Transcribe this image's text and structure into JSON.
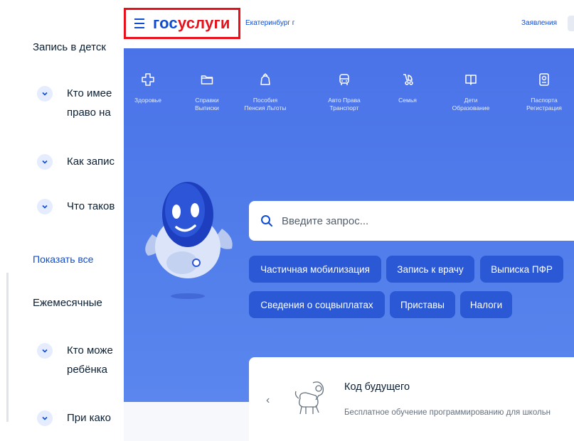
{
  "background": {
    "section1_heading": "Запись в детск",
    "faq_1_line1": "Кто имее",
    "faq_1_line2": "право на",
    "faq_2": "Как запис",
    "faq_3": "Что таков",
    "show_all": "Показать все",
    "section2_heading": "Ежемесячные",
    "faq_4_line1": "Кто може",
    "faq_4_line2": "ребёнка",
    "faq_5": "При како"
  },
  "header": {
    "logo_part1": "гос",
    "logo_part2": "услуги",
    "city": "Екатеринбург г",
    "statements_link": "Заявления"
  },
  "categories": [
    {
      "icon": "health-icon",
      "line1": "Здоровье",
      "line2": ""
    },
    {
      "icon": "folder-icon",
      "line1": "Справки",
      "line2": "Выписки"
    },
    {
      "icon": "benefits-icon",
      "line1": "Пособия",
      "line2": "Пенсия Льготы"
    },
    {
      "icon": "car-icon",
      "line1": "Авто Права",
      "line2": "Транспорт"
    },
    {
      "icon": "stroller-icon",
      "line1": "Семья",
      "line2": ""
    },
    {
      "icon": "book-icon",
      "line1": "Дети",
      "line2": "Образование"
    },
    {
      "icon": "passport-icon",
      "line1": "Паспорта",
      "line2": "Регистрация"
    }
  ],
  "search": {
    "placeholder": "Введите запрос..."
  },
  "chips": [
    "Частичная мобилизация",
    "Запись к врачу",
    "Выписка ПФР",
    "Сведения о соцвыплатах",
    "Приставы",
    "Налоги"
  ],
  "promo_card": {
    "prev_arrow": "‹",
    "title": "Код будущего",
    "description": "Бесплатное обучение программированию для школьн"
  },
  "colors": {
    "brand_blue": "#0d4cd3",
    "brand_red": "#e8101a",
    "hero_blue": "#4f7bea",
    "chip_blue": "#2b58d4"
  }
}
